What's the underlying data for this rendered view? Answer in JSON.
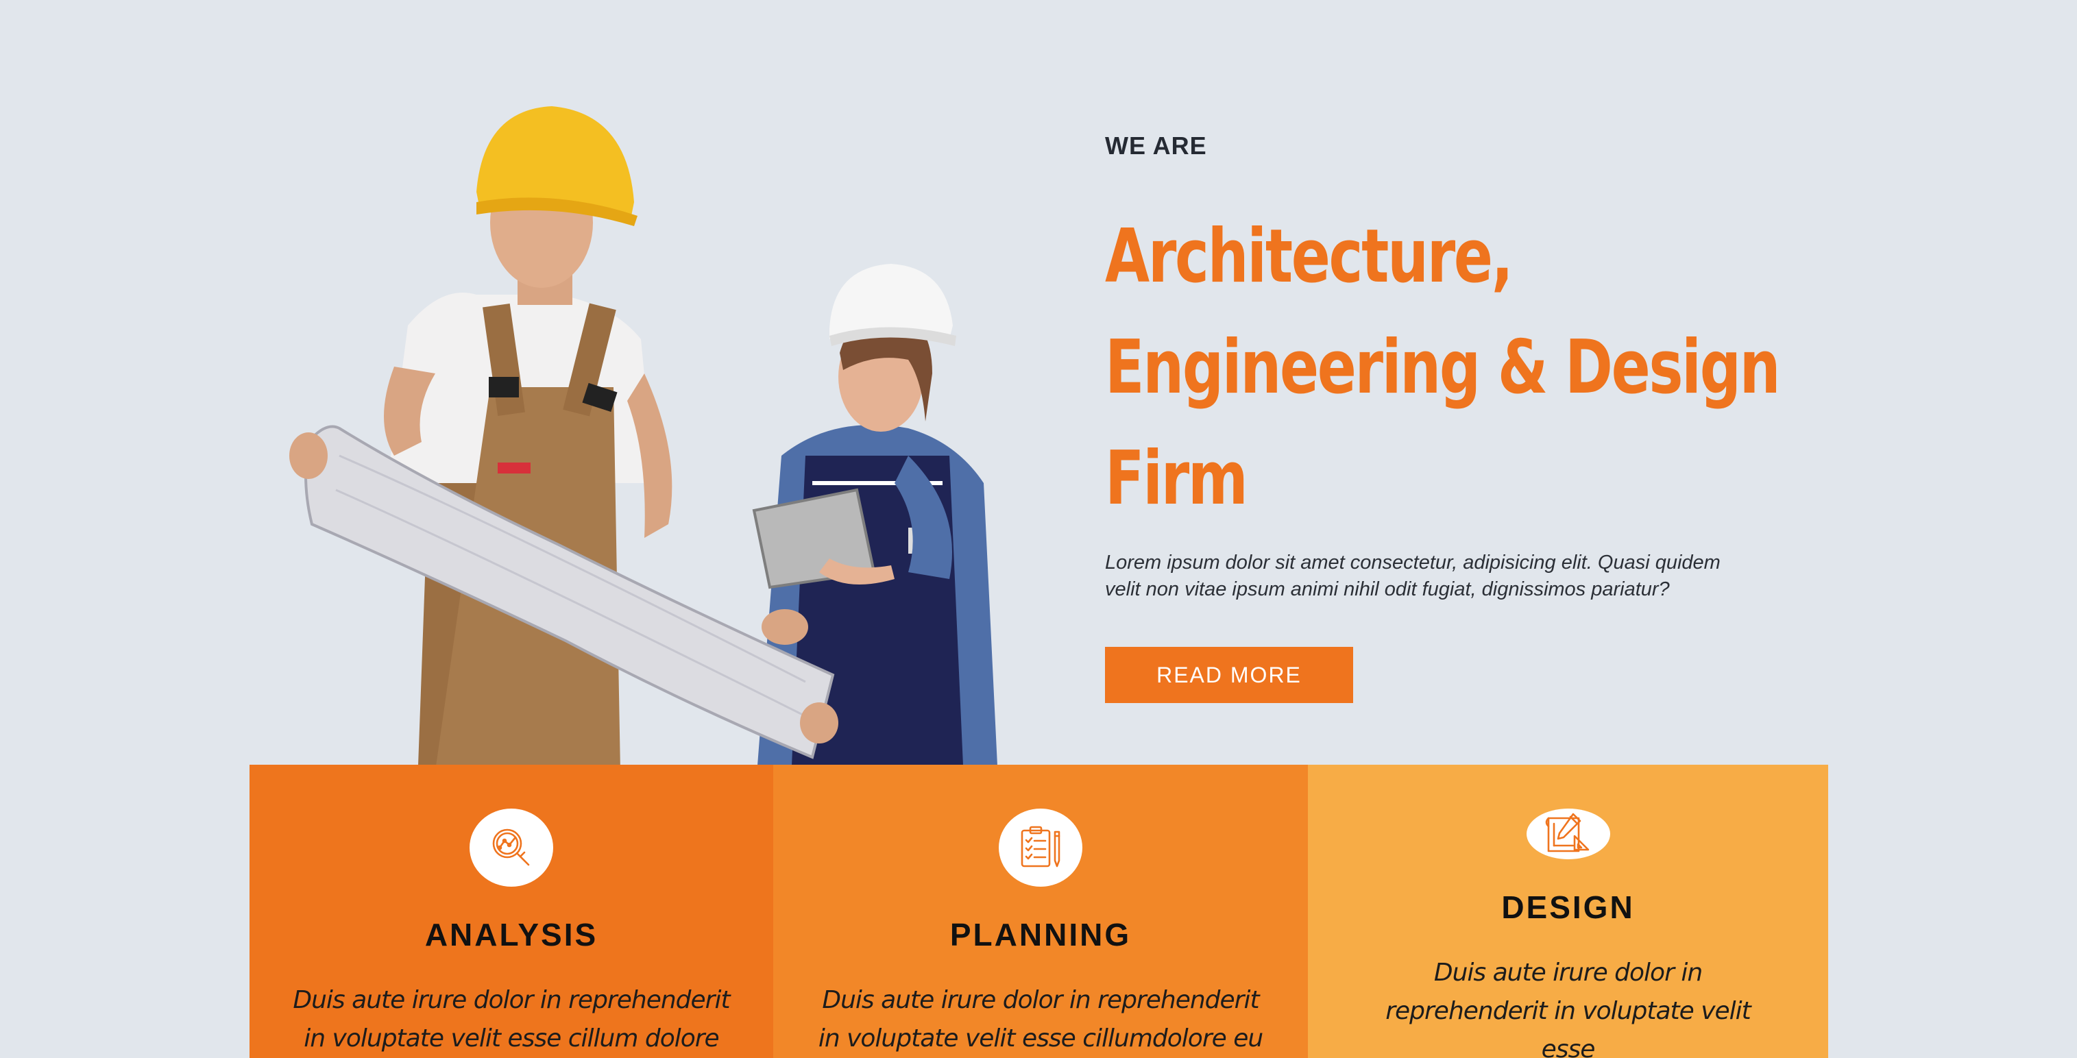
{
  "hero": {
    "eyebrow": "WE ARE",
    "headline_lines": [
      "Architecture,",
      "Engineering & Design",
      "Firm"
    ],
    "description": "Lorem ipsum dolor sit amet consectetur, adipisicing elit. Quasi quidem velit non vitae ipsum animi nihil odit fugiat, dignissimos pariatur?",
    "button_label": "READ MORE"
  },
  "features": [
    {
      "icon": "magnifier-chart-icon",
      "title": "ANALYSIS",
      "text": "Duis aute irure dolor in reprehenderit in voluptate velit esse cillum dolore"
    },
    {
      "icon": "clipboard-checklist-icon",
      "title": "PLANNING",
      "text": "Duis aute irure dolor in reprehenderit in voluptate velit esse cillumdolore eu"
    },
    {
      "icon": "blueprint-pencil-icon",
      "title": "DESIGN",
      "text": "Duis aute irure dolor in reprehenderit in voluptate velit esse"
    }
  ],
  "colors": {
    "background": "#e1e6ec",
    "accent": "#ef741e",
    "card_1": "#ee751d",
    "card_2": "#f28728",
    "card_3": "#f7ac46",
    "text_dark": "#252a33"
  }
}
